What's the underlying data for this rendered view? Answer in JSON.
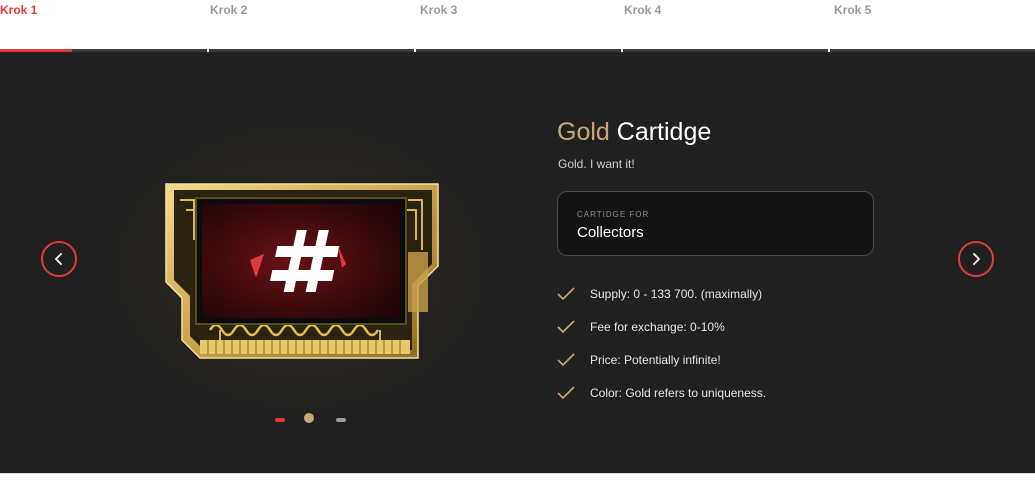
{
  "steps": [
    {
      "label": "Krok 1",
      "active": true
    },
    {
      "label": "Krok 2",
      "active": false
    },
    {
      "label": "Krok 3",
      "active": false
    },
    {
      "label": "Krok 4",
      "active": false
    },
    {
      "label": "Krok 5",
      "active": false
    }
  ],
  "progress": {
    "current_step": 1,
    "total_steps": 5
  },
  "product": {
    "title_accent": "Gold",
    "title_rest": "Cartidge",
    "subtitle": "Gold. I want it!",
    "card_label": "CARTIDGE FOR",
    "card_value": "Collectors",
    "features": [
      "Supply: 0 - 133 700. (maximally)",
      "Fee for exchange: 0-10%",
      "Price: Potentially infinite!",
      "Color: Gold refers to uniqueness."
    ]
  },
  "carousel": {
    "active_index": 1,
    "count": 3
  },
  "icons": {
    "prev": "chevron-left-icon",
    "next": "chevron-right-icon",
    "check": "check-icon"
  },
  "colors": {
    "accent_red": "#e03a3a",
    "gold": "#c9a874",
    "panel_bg": "#202020"
  }
}
